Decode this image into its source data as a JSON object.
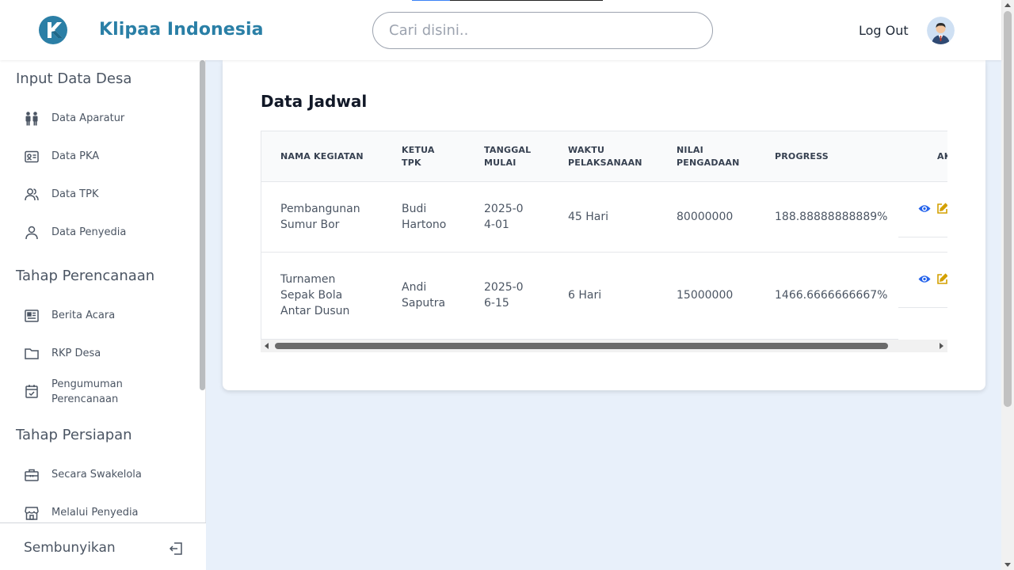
{
  "header": {
    "brand": "Klipaa Indonesia",
    "search_placeholder": "Cari disini..",
    "logout_label": "Log Out",
    "brand_color": "#2a7fa6"
  },
  "sidebar": {
    "sections": [
      {
        "title": "Input Data Desa",
        "items": [
          {
            "label": "Data Aparatur",
            "icon": "people-icon"
          },
          {
            "label": "Data PKA",
            "icon": "id-card-icon"
          },
          {
            "label": "Data TPK",
            "icon": "users-icon"
          },
          {
            "label": "Data Penyedia",
            "icon": "user-icon"
          }
        ]
      },
      {
        "title": "Tahap Perencanaan",
        "items": [
          {
            "label": "Berita Acara",
            "icon": "newspaper-icon"
          },
          {
            "label": "RKP Desa",
            "icon": "folder-icon"
          },
          {
            "label": "Pengumuman Perencanaan",
            "icon": "calendar-check-icon"
          }
        ]
      },
      {
        "title": "Tahap Persiapan",
        "items": [
          {
            "label": "Secara Swakelola",
            "icon": "briefcase-icon"
          },
          {
            "label": "Melalui Penyedia",
            "icon": "store-icon"
          }
        ]
      }
    ],
    "footer_label": "Sembunyikan"
  },
  "main": {
    "title": "Data Jadwal",
    "columns": [
      "NAMA KEGIATAN",
      "KETUA TPK",
      "TANGGAL MULAI",
      "WAKTU PELAKSANAAN",
      "NILAI PENGADAAN",
      "PROGRESS",
      "AK"
    ],
    "rows": [
      {
        "nama": "Pembangunan Sumur Bor",
        "ketua": "Budi Hartono",
        "tanggal": "2025-04-01",
        "waktu": "45 Hari",
        "nilai": "80000000",
        "progress": "188.88888888889%"
      },
      {
        "nama": "Turnamen Sepak Bola Antar Dusun",
        "ketua": "Andi Saputra",
        "tanggal": "2025-06-15",
        "waktu": "6 Hari",
        "nilai": "15000000",
        "progress": "1466.6666666667%"
      }
    ]
  }
}
